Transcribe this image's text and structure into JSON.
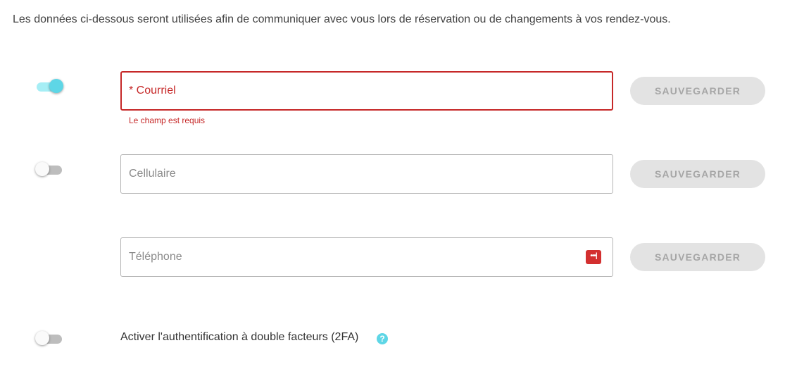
{
  "intro_text": "Les données ci-dessous seront utilisées afin de communiquer avec vous lors de réservation ou de changements à vos rendez-vous.",
  "email": {
    "placeholder": "* Courriel",
    "value": "",
    "error_text": "Le champ est requis",
    "toggle_on": true,
    "save_label": "SAUVEGARDER"
  },
  "cell": {
    "placeholder": "Cellulaire",
    "value": "",
    "toggle_on": false,
    "save_label": "SAUVEGARDER"
  },
  "phone": {
    "placeholder": "Téléphone",
    "value": "",
    "icon": "password-manager-icon",
    "save_label": "SAUVEGARDER"
  },
  "tfa": {
    "label": "Activer l'authentification à double facteurs (2FA)",
    "toggle_on": false,
    "help_glyph": "?"
  },
  "colors": {
    "accent": "#5ed6e6",
    "error": "#c62828",
    "button_bg": "#e3e3e3",
    "button_text": "#a6a6a6"
  }
}
